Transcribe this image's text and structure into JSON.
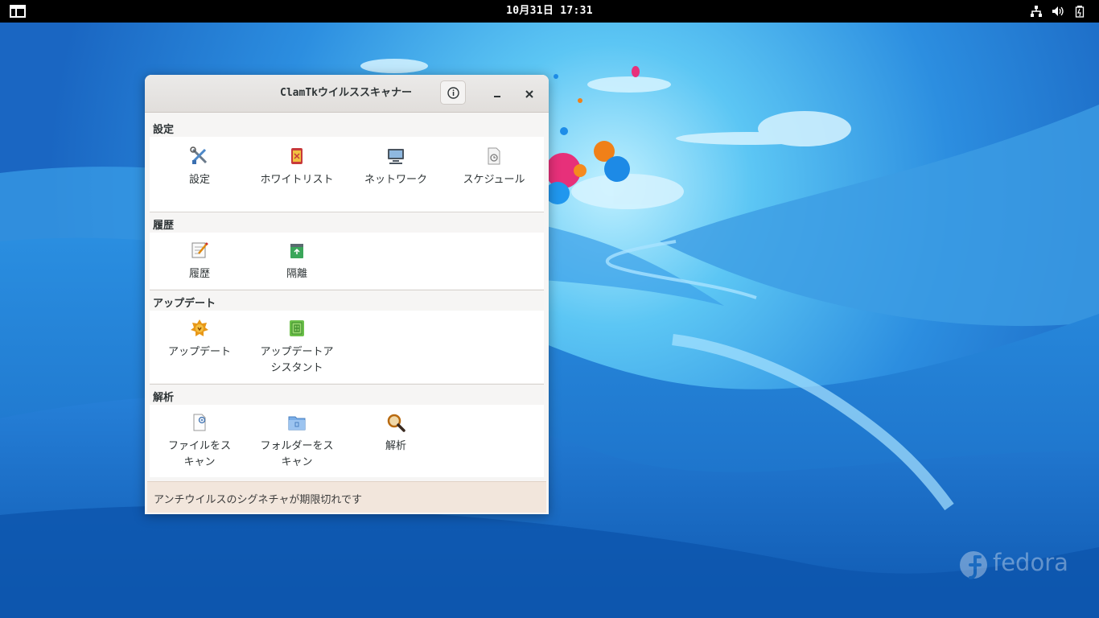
{
  "topbar": {
    "clock": "10月31日  17:31"
  },
  "desktop": {
    "watermark": "fedora",
    "colors": {
      "sky": "#5fc4f2",
      "hills": "#1f74c9",
      "deep": "#0f5fb5"
    }
  },
  "window": {
    "title": "ClamTkウイルススキャナー",
    "sections": [
      {
        "title": "設定",
        "items": [
          {
            "label": "設定",
            "icon": "tools-icon"
          },
          {
            "label": "ホワイトリスト",
            "icon": "shield-icon"
          },
          {
            "label": "ネットワーク",
            "icon": "network-icon"
          },
          {
            "label": "スケジュール",
            "icon": "schedule-icon"
          }
        ]
      },
      {
        "title": "履歴",
        "items": [
          {
            "label": "履歴",
            "icon": "notepad-icon"
          },
          {
            "label": "隔離",
            "icon": "quarantine-icon"
          }
        ]
      },
      {
        "title": "アップデート",
        "items": [
          {
            "label": "アップデート",
            "icon": "update-icon"
          },
          {
            "label": "アップデートアシスタント",
            "label_lines": [
              "アップデートア",
              "シスタント"
            ],
            "icon": "update-assistant-icon"
          }
        ]
      },
      {
        "title": "解析",
        "items": [
          {
            "label": "ファイルをスキャン",
            "label_lines": [
              "ファイルをス",
              "キャン"
            ],
            "icon": "scan-file-icon"
          },
          {
            "label": "フォルダーをスキャン",
            "label_lines": [
              "フォルダーをス",
              "キャン"
            ],
            "icon": "scan-folder-icon"
          },
          {
            "label": "解析",
            "icon": "magnifier-icon"
          }
        ]
      }
    ],
    "status": "アンチウイルスのシグネチャが期限切れです"
  }
}
